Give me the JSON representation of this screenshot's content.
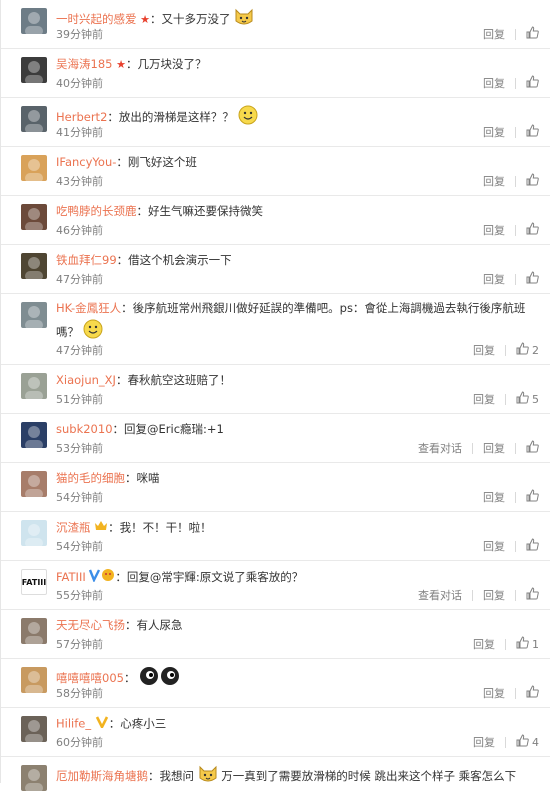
{
  "actions": {
    "reply": "回复",
    "view_dialog": "查看对话"
  },
  "comments": [
    {
      "name": "一时兴起的感爱",
      "badge": "star",
      "text": "：又十多万没了",
      "emoji": "cat",
      "time": "39分钟前",
      "likes": "",
      "dialog": false,
      "avatar": "#6d7c86"
    },
    {
      "name": "吴海涛185",
      "badge": "star",
      "text": "：几万块没了？",
      "emoji": "",
      "time": "40分钟前",
      "likes": "",
      "dialog": false,
      "avatar": "#3c3c3c"
    },
    {
      "name": "Herbert2",
      "badge": "",
      "text": "：放出的滑梯是这样？？",
      "emoji": "smile",
      "time": "41分钟前",
      "likes": "",
      "dialog": false,
      "avatar": "#59636a"
    },
    {
      "name": "IFancyYou-",
      "badge": "",
      "text": "：刚飞好这个班",
      "emoji": "",
      "time": "43分钟前",
      "likes": "",
      "dialog": false,
      "avatar": "#d9a25a"
    },
    {
      "name": "吃鸭脖的长颈鹿",
      "badge": "",
      "text": "：好生气嘛还要保持微笑",
      "emoji": "",
      "time": "46分钟前",
      "likes": "",
      "dialog": false,
      "avatar": "#6c4a3a"
    },
    {
      "name": "铁血拜仁99",
      "badge": "",
      "text": "：借这个机会演示一下",
      "emoji": "",
      "time": "47分钟前",
      "likes": "",
      "dialog": false,
      "avatar": "#4f4633"
    },
    {
      "name": "HK-金鳳狂人",
      "badge": "",
      "text": "：後序航班常州飛銀川做好延誤的準備吧。ps：會從上海調機過去執行後序航班嗎？",
      "emoji": "smile",
      "time": "47分钟前",
      "likes": "2",
      "dialog": false,
      "avatar": "#7f8d92"
    },
    {
      "name": "Xiaojun_XJ",
      "badge": "",
      "text": "：春秋航空这班赔了！",
      "emoji": "",
      "time": "51分钟前",
      "likes": "5",
      "dialog": false,
      "avatar": "#9aa195"
    },
    {
      "name": "subk2010",
      "badge": "",
      "text": "：回复@Eric瘾瑞:+1",
      "emoji": "",
      "time": "53分钟前",
      "likes": "",
      "dialog": true,
      "avatar": "#2b3f66"
    },
    {
      "name": "猫的毛的细胞",
      "badge": "",
      "text": "：咪喵",
      "emoji": "",
      "time": "54分钟前",
      "likes": "",
      "dialog": false,
      "avatar": "#a77d6a"
    },
    {
      "name": "沉渣瓶",
      "badge": "crown",
      "text": "：我！不！干！啦！",
      "emoji": "",
      "time": "54分钟前",
      "likes": "",
      "dialog": false,
      "avatar": "#cfe4ee"
    },
    {
      "name": "FATIII",
      "badge": "v",
      "text": "：回复@常宇輝:原文说了乘客放的？",
      "emoji": "",
      "time": "55分钟前",
      "likes": "",
      "dialog": true,
      "avatar": "#ffffff",
      "avatar_text": "FATIII"
    },
    {
      "name": "天无尽心飞扬",
      "badge": "",
      "text": "：有人尿急",
      "emoji": "",
      "time": "57分钟前",
      "likes": "1",
      "dialog": false,
      "avatar": "#8b7a6b"
    },
    {
      "name": "嘻嘻嘻嘻005",
      "badge": "",
      "text": "：",
      "emoji": "eyes",
      "time": "58分钟前",
      "likes": "",
      "dialog": false,
      "avatar": "#c89a60"
    },
    {
      "name": "Hilife_",
      "badge": "vgold",
      "text": "：心疼小三",
      "emoji": "",
      "time": "60分钟前",
      "likes": "4",
      "dialog": false,
      "avatar": "#6b6258"
    },
    {
      "name": "厄加勒斯海角塘鹅",
      "badge": "",
      "text": "：我想问",
      "text2": " 万一真到了需要放滑梯的时候 跳出来这个样子 乘客怎么下",
      "emoji": "cat",
      "time": "",
      "likes": "",
      "dialog": false,
      "avatar": "#8c8170"
    }
  ]
}
